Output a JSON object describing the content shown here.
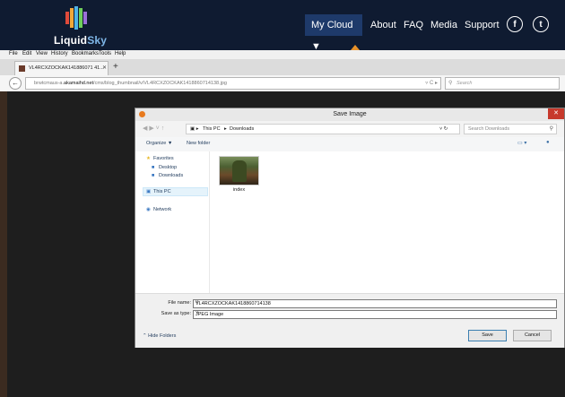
{
  "site": {
    "logo_liquid": "Liquid",
    "logo_sky": "Sky",
    "nav": {
      "my_cloud": "My Cloud ▼",
      "about": "About",
      "faq": "FAQ",
      "media": "Media",
      "support": "Support"
    },
    "social_icons": [
      "facebook-icon",
      "twitter-icon"
    ],
    "accent_color": "#e8922a"
  },
  "browser": {
    "menu": [
      "File",
      "Edit",
      "View",
      "History",
      "Bookmarks",
      "Tools",
      "Help"
    ],
    "tab_title": "VL4RCXZOCKAK141886071 41...",
    "new_tab": "+",
    "url_prefix": "brwtcmaus-a.",
    "url_domain": "akamaihd.net",
    "url_path": "/cms/blog_thumbnail/v/VL4RCXZOCKAK1418860714138.jpg",
    "search_placeholder": "Search"
  },
  "dialog": {
    "title": "Save Image",
    "breadcrumb": [
      "This PC",
      "Downloads"
    ],
    "search_placeholder": "Search Downloads",
    "toolbar": {
      "organize": "Organize ▼",
      "new_folder": "New folder"
    },
    "sidebar": {
      "favorites": "Favorites",
      "desktop": "Desktop",
      "downloads": "Downloads",
      "this_pc": "This PC",
      "network": "Network"
    },
    "files": [
      {
        "name": "index"
      }
    ],
    "file_name_label": "File name:",
    "file_name_value": "VL4RCXZOCKAK1418860714138",
    "save_type_label": "Save as type:",
    "save_type_value": "JPEG Image",
    "hide_folders": "Hide Folders",
    "save_button": "Save",
    "cancel_button": "Cancel"
  }
}
